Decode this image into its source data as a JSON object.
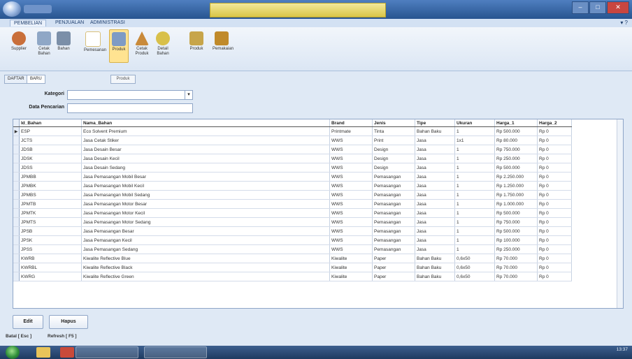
{
  "titlebar": {
    "title": ""
  },
  "ribbon": {
    "tabs": [
      "PEMBELIAN",
      "PENJUALAN",
      "ADMINISTRASI"
    ],
    "buttons": [
      {
        "label": "Supplier",
        "color": "#c96f3a"
      },
      {
        "label": "Cetak Bahan",
        "color": "#8fa7c6"
      },
      {
        "label": "Bahan",
        "color": "#7b8fa8"
      },
      {
        "label": "Pemesanan",
        "color": "#d9c07a"
      },
      {
        "label": "Produk",
        "color": "#7f9bc4"
      },
      {
        "label": "Cetak Produk",
        "color": "#c98a3a"
      },
      {
        "label": "Detail Bahan",
        "color": "#d8c04a"
      },
      {
        "label": "Produk",
        "color": "#c7a54a"
      },
      {
        "label": "Pemakaian",
        "color": "#c08a2a"
      }
    ]
  },
  "form": {
    "tabs": [
      "DAFTAR",
      "BARU"
    ],
    "filter_button": "Produk",
    "kategori_label": "Kategori",
    "kategori_value": "",
    "pencarian_label": "Data Pencarian",
    "pencarian_value": ""
  },
  "grid": {
    "columns": [
      "Id_Bahan",
      "Nama_Bahan",
      "Brand",
      "Jenis",
      "Tipe",
      "Ukuran",
      "Harga_1",
      "Harga_2"
    ],
    "rows": [
      [
        "ESP",
        "Eco Solvent Premium",
        "Printmate",
        "Tinta",
        "Bahan Baku",
        "1",
        "Rp 500.000",
        "Rp 0"
      ],
      [
        "JCTS",
        "Jasa Cetak Stiker",
        "WWS",
        "Print",
        "Jasa",
        "1x1",
        "Rp 80.000",
        "Rp 0"
      ],
      [
        "JDSB",
        "Jasa Desain Besar",
        "WWS",
        "Design",
        "Jasa",
        "1",
        "Rp 750.000",
        "Rp 0"
      ],
      [
        "JDSK",
        "Jasa Desain Kecil",
        "WWS",
        "Design",
        "Jasa",
        "1",
        "Rp 250.000",
        "Rp 0"
      ],
      [
        "JDSS",
        "Jasa Desain Sedang",
        "WWS",
        "Design",
        "Jasa",
        "1",
        "Rp 500.000",
        "Rp 0"
      ],
      [
        "JPMBB",
        "Jasa Pemasangan Mobil Besar",
        "WWS",
        "Pemasangan",
        "Jasa",
        "1",
        "Rp 2.250.000",
        "Rp 0"
      ],
      [
        "JPMBK",
        "Jasa Pemasangan Mobil Kecil",
        "WWS",
        "Pemasangan",
        "Jasa",
        "1",
        "Rp 1.250.000",
        "Rp 0"
      ],
      [
        "JPMBS",
        "Jasa Pemasangan Mobil Sedang",
        "WWS",
        "Pemasangan",
        "Jasa",
        "1",
        "Rp 1.750.000",
        "Rp 0"
      ],
      [
        "JPMTB",
        "Jasa Pemasangan Motor Besar",
        "WWS",
        "Pemasangan",
        "Jasa",
        "1",
        "Rp 1.000.000",
        "Rp 0"
      ],
      [
        "JPMTK",
        "Jasa Pemasangan Motor Kecil",
        "WWS",
        "Pemasangan",
        "Jasa",
        "1",
        "Rp 500.000",
        "Rp 0"
      ],
      [
        "JPMTS",
        "Jasa Pemasangan Motor Sedang",
        "WWS",
        "Pemasangan",
        "Jasa",
        "1",
        "Rp 750.000",
        "Rp 0"
      ],
      [
        "JPSB",
        "Jasa Pemasangan Besar",
        "WWS",
        "Pemasangan",
        "Jasa",
        "1",
        "Rp 500.000",
        "Rp 0"
      ],
      [
        "JPSK",
        "Jasa Pemasangan Kecil",
        "WWS",
        "Pemasangan",
        "Jasa",
        "1",
        "Rp 100.000",
        "Rp 0"
      ],
      [
        "JPSS",
        "Jasa Pemasangan Sedang",
        "WWS",
        "Pemasangan",
        "Jasa",
        "1",
        "Rp 250.000",
        "Rp 0"
      ],
      [
        "KWRB",
        "Kiwalite Reflective Blue",
        "Kiwalite",
        "Paper",
        "Bahan Baku",
        "0,6x50",
        "Rp 70.000",
        "Rp 0"
      ],
      [
        "KWRBL",
        "Kiwalite Reflective Black",
        "Kiwalite",
        "Paper",
        "Bahan Baku",
        "0,6x50",
        "Rp 70.000",
        "Rp 0"
      ],
      [
        "KWRG",
        "Kiwalite Reflective Green",
        "Kiwalite",
        "Paper",
        "Bahan Baku",
        "0,6x50",
        "Rp 70.000",
        "Rp 0"
      ]
    ]
  },
  "buttons": {
    "edit": "Edit",
    "hapus": "Hapus"
  },
  "shortcuts": {
    "batal": "Batal [ Esc ]",
    "refresh": "Refresh [ F5 ]"
  },
  "taskbar": {
    "clock": "13:37"
  },
  "colors": {
    "ribbon_selected": "#ffe391",
    "titlebar": "#27548f"
  }
}
